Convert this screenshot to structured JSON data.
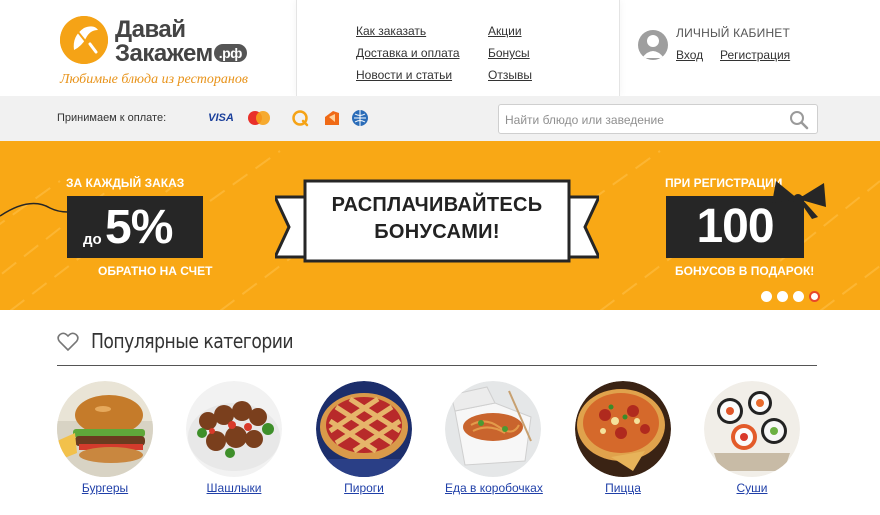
{
  "brand": {
    "line1": "Давай",
    "line2": "Закажем",
    "tld": ".рф",
    "slogan": "Любимые блюда из ресторанов",
    "accent": "#f5a316"
  },
  "nav": {
    "how_to_order": "Как заказать",
    "delivery": "Доставка и оплата",
    "news": "Новости и статьи",
    "promos": "Акции",
    "bonuses": "Бонусы",
    "reviews": "Отзывы"
  },
  "account": {
    "title": "Личный кабинет",
    "login": "Вход",
    "register": "Регистрация"
  },
  "payment": {
    "label": "Принимаем к оплате:",
    "visa": "VISA",
    "methods": [
      "visa-icon",
      "mastercard-icon",
      "qiwi-icon",
      "yandex-money-icon",
      "webmoney-icon"
    ]
  },
  "search": {
    "placeholder": "Найти блюдо или заведение"
  },
  "banner": {
    "left_top": "ЗА КАЖДЫЙ ЗАКАЗ",
    "left_prefix": "до",
    "left_value": "5%",
    "left_bottom": "ОБРАТНО НА СЧЕТ",
    "center_line1": "РАСПЛАЧИВАЙТЕСЬ",
    "center_line2": "БОНУСАМИ!",
    "right_top": "ПРИ РЕГИСТРАЦИИ",
    "right_value": "100",
    "right_bottom": "БОНУСОВ В ПОДАРОК!",
    "background": "#f9a815",
    "slides": 4,
    "active_slide": 4
  },
  "categories": {
    "title": "Популярные категории",
    "items": [
      {
        "label": "Бургеры"
      },
      {
        "label": "Шашлыки"
      },
      {
        "label": "Пироги"
      },
      {
        "label": "Еда в коробочках"
      },
      {
        "label": "Пицца"
      },
      {
        "label": "Суши"
      }
    ]
  }
}
